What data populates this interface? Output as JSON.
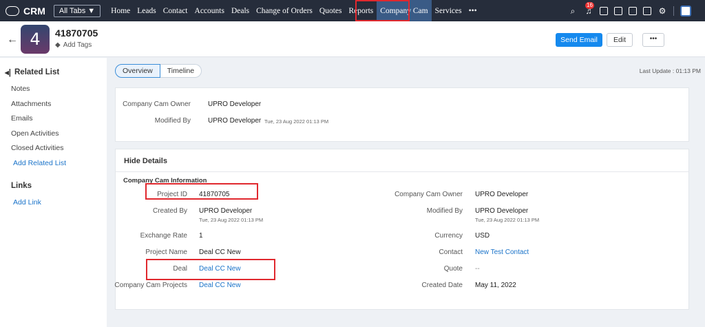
{
  "topbar": {
    "app_name": "CRM",
    "all_tabs_label": "All Tabs ▼",
    "tabs": [
      "Home",
      "Leads",
      "Contact",
      "Accounts",
      "Deals",
      "Change of Orders",
      "Quotes",
      "Reports",
      "Company Cam",
      "Services",
      "•••"
    ],
    "active_tab": "Company Cam",
    "notification_count": "16",
    "icons": [
      "search-icon",
      "bell-icon",
      "calendar-icon",
      "screen-icon",
      "mail-icon",
      "store-icon",
      "gear-icon",
      "user-avatar"
    ]
  },
  "record": {
    "avatar_letter": "4",
    "id": "41870705",
    "add_tags": "Add Tags",
    "buttons": {
      "send_email": "Send Email",
      "edit": "Edit",
      "more": "•••"
    }
  },
  "sidebar": {
    "related_list_title": "Related List",
    "items": [
      "Notes",
      "Attachments",
      "Emails",
      "Open Activities",
      "Closed Activities"
    ],
    "add_related": "Add Related List",
    "links_title": "Links",
    "add_link": "Add Link"
  },
  "view_tabs": {
    "overview": "Overview",
    "timeline": "Timeline"
  },
  "last_update": "Last Update : 01:13 PM",
  "summary": {
    "owner_label": "Company Cam Owner",
    "owner_value": "UPRO Developer",
    "modified_label": "Modified By",
    "modified_value": "UPRO Developer",
    "modified_time": "Tue, 23 Aug 2022 01:13 PM"
  },
  "details": {
    "hide_label": "Hide Details",
    "section_title": "Company Cam Information",
    "left": {
      "project_id_label": "Project ID",
      "project_id": "41870705",
      "created_by_label": "Created By",
      "created_by": "UPRO Developer",
      "created_time": "Tue, 23 Aug 2022 01:13 PM",
      "exchange_rate_label": "Exchange Rate",
      "exchange_rate": "1",
      "project_name_label": "Project Name",
      "project_name": "Deal CC New",
      "deal_label": "Deal",
      "deal": "Deal CC New",
      "projects_label": "Company Cam Projects",
      "projects": "Deal CC New"
    },
    "right": {
      "owner_label": "Company Cam Owner",
      "owner": "UPRO Developer",
      "modified_label": "Modified By",
      "modified": "UPRO Developer",
      "modified_time": "Tue, 23 Aug 2022 01:13 PM",
      "currency_label": "Currency",
      "currency": "USD",
      "contact_label": "Contact",
      "contact": "New Test Contact",
      "quote_label": "Quote",
      "quote": "--",
      "created_date_label": "Created Date",
      "created_date": "May 11, 2022"
    }
  },
  "colors": {
    "topbar": "#262d3b",
    "active_tab": "#3a5b86",
    "primary": "#1589ee",
    "link": "#1a73c9",
    "highlight": "#e0282e"
  }
}
